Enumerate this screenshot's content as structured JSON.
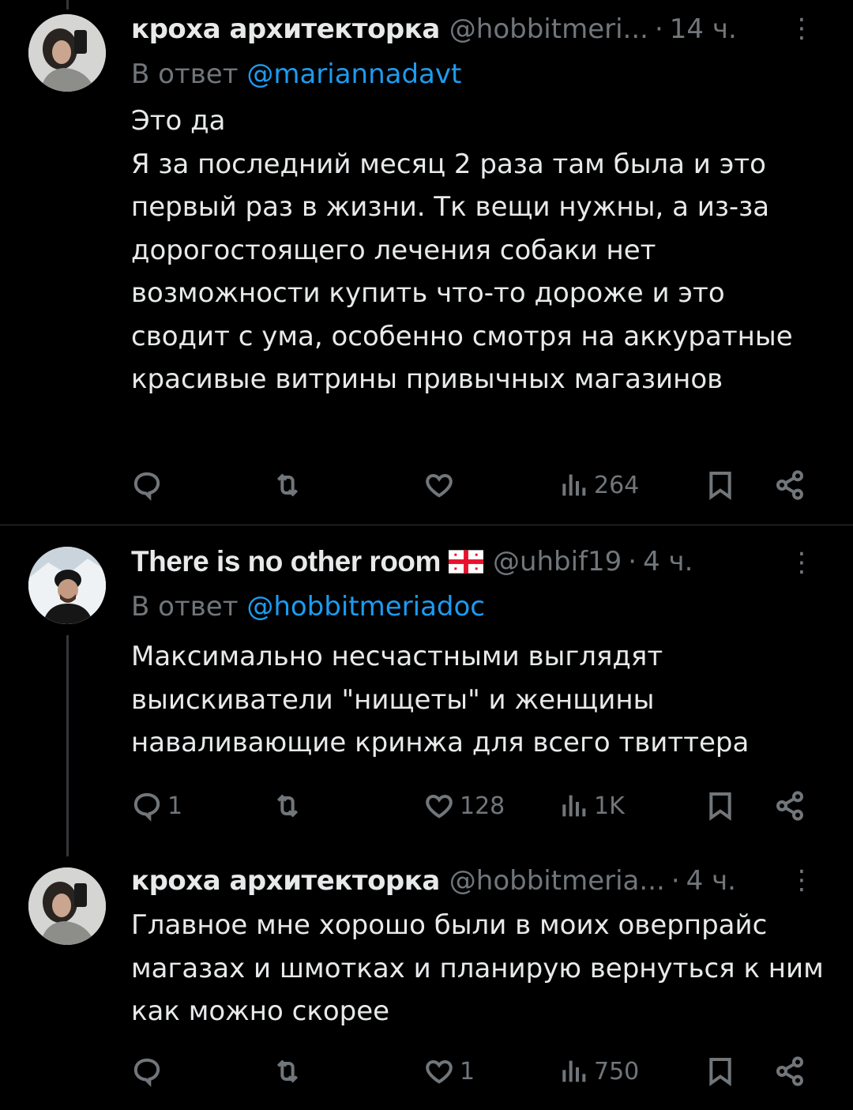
{
  "tweets": [
    {
      "name": "кроха архитекторка",
      "handle": "@hobbitmeri...",
      "dot": "·",
      "time": "14 ч.",
      "more": "⋮",
      "reply_prefix": "В ответ",
      "reply_to": "@mariannadavt",
      "text": "Это да\nЯ за последний месяц 2 раза там была и это первый раз в жизни. Тк вещи нужны, а из-за дорогостоящего лечения собаки нет возможности купить что-то дороже и это сводит с ума, особенно смотря на аккуратные красивые витрины привычных магазинов",
      "replies": "",
      "retweets": "",
      "likes": "",
      "views": "264"
    },
    {
      "name": "There is no other room",
      "flag": "georgia-flag",
      "handle": "@uhbif19",
      "dot": "·",
      "time": "4 ч.",
      "more": "⋮",
      "reply_prefix": "В ответ",
      "reply_to": "@hobbitmeriadoc",
      "text": "Максимально несчастными выглядят выискиватели \"нищеты\" и женщины наваливающие кринжа для всего твиттера",
      "replies": "1",
      "retweets": "",
      "likes": "128",
      "views": "1K"
    },
    {
      "name": "кроха архитекторка",
      "handle": "@hobbitmeria...",
      "dot": "·",
      "time": "4 ч.",
      "more": "⋮",
      "text": "Главное мне хорошо были в моих оверпрайс магазах и шмотках и планирую вернуться к ним как можно скорее",
      "replies": "",
      "retweets": "",
      "likes": "1",
      "views": "750"
    }
  ],
  "colors": {
    "background": "#000000",
    "text": "#e7e9ea",
    "muted": "#71767b",
    "link": "#1d9bf0",
    "divider": "#2f3336"
  },
  "icons": [
    "reply-icon",
    "retweet-icon",
    "like-icon",
    "views-icon",
    "bookmark-icon",
    "share-icon",
    "more-icon"
  ]
}
